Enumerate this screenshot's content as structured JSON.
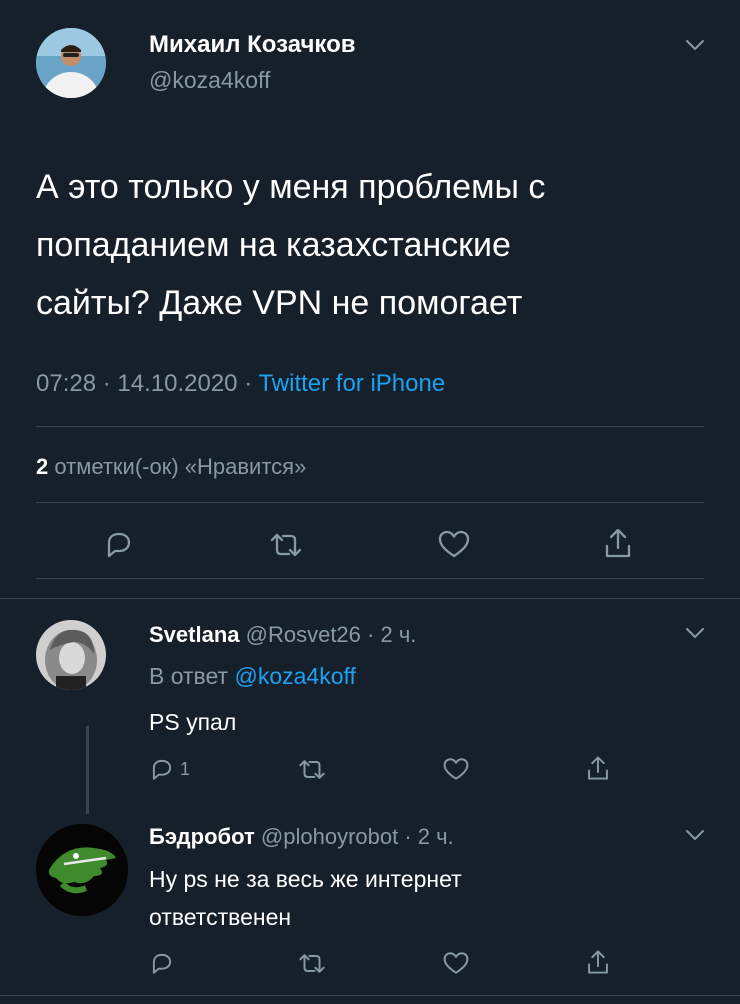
{
  "main_tweet": {
    "author_name": "Михаил Козачков",
    "author_handle": "@koza4koff",
    "text_lines": [
      "А это только у меня проблемы с",
      "попаданием на казахстанские",
      "сайты? Даже VPN не помогает"
    ],
    "time": "07:28",
    "separator": "·",
    "date": "14.10.2020",
    "source": "Twitter for iPhone",
    "likes_count": "2",
    "likes_label": "отметки(-ок) «Нравится»"
  },
  "replies": [
    {
      "author_name": "Svetlana",
      "author_handle": "@Rosvet26",
      "time_ago": "2 ч.",
      "reply_to_prefix": "В ответ",
      "reply_to_handle": "@koza4koff",
      "text_lines": [
        "PS упал"
      ],
      "reply_count": "1"
    },
    {
      "author_name": "Бэдробот",
      "author_handle": "@plohoyrobot",
      "time_ago": "2 ч.",
      "text_lines": [
        "Ну ps не за весь же интернет",
        "ответственен"
      ]
    }
  ],
  "icons": {
    "reply": "reply-icon",
    "retweet": "retweet-icon",
    "like": "heart-icon",
    "share": "share-icon",
    "menu": "chevron-down-icon"
  },
  "colors": {
    "background": "#15202b",
    "text": "#ffffff",
    "muted": "#8899a6",
    "accent": "#1da1f2",
    "divider": "#38444d"
  }
}
